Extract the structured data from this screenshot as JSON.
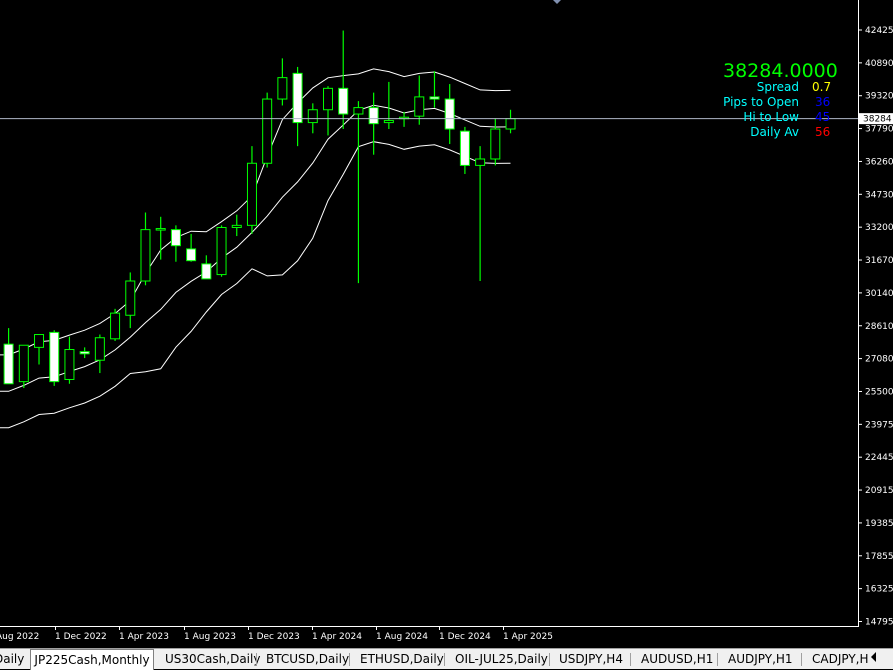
{
  "chart_data": {
    "type": "candlestick",
    "symbol": "JP225Cash",
    "timeframe": "Monthly",
    "price_ticks": [
      "42425",
      "40890",
      "39320",
      "37790",
      "36260",
      "34730",
      "33200",
      "31670",
      "30140",
      "28610",
      "27080",
      "25500",
      "23975",
      "22445",
      "20915",
      "19385",
      "17855",
      "16325",
      "14795"
    ],
    "date_ticks": [
      "Aug 2022",
      "1 Dec 2022",
      "1 Apr 2023",
      "1 Aug 2023",
      "1 Dec 2023",
      "1 Apr 2024",
      "1 Aug 2024",
      "1 Dec 2024",
      "1 Apr 2025"
    ],
    "current_price": "38284",
    "ylim": [
      14795,
      42425
    ],
    "colors": {
      "bull_body": "#000000",
      "bear_body": "#ffffff",
      "wick": "#00ff00",
      "bands": "#ffffff",
      "price_line": "#b0b8c8"
    },
    "candles": [
      {
        "o": 27750,
        "h": 28500,
        "l": 26200,
        "c": 25900
      },
      {
        "o": 26000,
        "h": 27700,
        "l": 25700,
        "c": 27700
      },
      {
        "o": 27600,
        "h": 28200,
        "l": 26800,
        "c": 28200
      },
      {
        "o": 28300,
        "h": 28400,
        "l": 25800,
        "c": 26000
      },
      {
        "o": 26100,
        "h": 28100,
        "l": 25900,
        "c": 27500
      },
      {
        "o": 27400,
        "h": 27600,
        "l": 27100,
        "c": 27300
      },
      {
        "o": 27000,
        "h": 28200,
        "l": 26400,
        "c": 28050
      },
      {
        "o": 28000,
        "h": 29400,
        "l": 27900,
        "c": 29200
      },
      {
        "o": 29100,
        "h": 31100,
        "l": 28500,
        "c": 30700
      },
      {
        "o": 30700,
        "h": 33900,
        "l": 30500,
        "c": 33100
      },
      {
        "o": 33100,
        "h": 33700,
        "l": 31700,
        "c": 33150
      },
      {
        "o": 33100,
        "h": 33300,
        "l": 31600,
        "c": 32350
      },
      {
        "o": 32200,
        "h": 32900,
        "l": 31600,
        "c": 31650
      },
      {
        "o": 31500,
        "h": 31900,
        "l": 30800,
        "c": 30800
      },
      {
        "o": 31000,
        "h": 33300,
        "l": 30900,
        "c": 33200
      },
      {
        "o": 33200,
        "h": 33800,
        "l": 32800,
        "c": 33300
      },
      {
        "o": 33300,
        "h": 37000,
        "l": 32900,
        "c": 36200
      },
      {
        "o": 36200,
        "h": 39500,
        "l": 36000,
        "c": 39200
      },
      {
        "o": 39200,
        "h": 41100,
        "l": 38900,
        "c": 40200
      },
      {
        "o": 40400,
        "h": 40700,
        "l": 37000,
        "c": 38100
      },
      {
        "o": 38100,
        "h": 39000,
        "l": 37600,
        "c": 38700
      },
      {
        "o": 38700,
        "h": 39800,
        "l": 37500,
        "c": 39700
      },
      {
        "o": 39700,
        "h": 42400,
        "l": 37800,
        "c": 38500
      },
      {
        "o": 38500,
        "h": 39100,
        "l": 30600,
        "c": 38800
      },
      {
        "o": 38800,
        "h": 39500,
        "l": 36600,
        "c": 38050
      },
      {
        "o": 38100,
        "h": 40000,
        "l": 37800,
        "c": 38200
      },
      {
        "o": 38300,
        "h": 38600,
        "l": 37900,
        "c": 38350
      },
      {
        "o": 38400,
        "h": 40300,
        "l": 38000,
        "c": 39300
      },
      {
        "o": 39300,
        "h": 40500,
        "l": 38800,
        "c": 39200
      },
      {
        "o": 39200,
        "h": 39900,
        "l": 37100,
        "c": 37800
      },
      {
        "o": 37700,
        "h": 37900,
        "l": 35700,
        "c": 36100
      },
      {
        "o": 36100,
        "h": 37000,
        "l": 30700,
        "c": 36400
      },
      {
        "o": 36400,
        "h": 38300,
        "l": 36100,
        "c": 37800
      },
      {
        "o": 37800,
        "h": 38700,
        "l": 37600,
        "c": 38284
      }
    ],
    "bands": {
      "upper": [
        null,
        null,
        null,
        null,
        null,
        null,
        null,
        null,
        null,
        null,
        null,
        null,
        null,
        null,
        null,
        null,
        null,
        null,
        null,
        null,
        null,
        null,
        null,
        null,
        null,
        null,
        null,
        null,
        null,
        null,
        null,
        null,
        null,
        null
      ],
      "middle": [],
      "lower": []
    }
  },
  "info_panel": {
    "price": "38284.0000",
    "spread_label": "Spread",
    "spread_value": "0.7",
    "pips_to_open_label": "Pips to Open",
    "pips_to_open_value": "36",
    "hi_to_low_label": "Hi to Low",
    "hi_to_low_value": "45",
    "daily_av_label": "Daily Av",
    "daily_av_value": "56",
    "colors": {
      "price": "#00ff00",
      "labels": "#00ffff",
      "spread_value": "#ffff00",
      "pips_value": "#0000ff",
      "hilo_value": "#0000ff",
      "dailyav_value": "#ff0000"
    }
  },
  "tabs": [
    {
      "label": "Daily"
    },
    {
      "label": "JP225Cash,Monthly"
    },
    {
      "label": "US30Cash,Daily"
    },
    {
      "label": "BTCUSD,Daily"
    },
    {
      "label": "ETHUSD,Daily"
    },
    {
      "label": "OIL-JUL25,Daily"
    },
    {
      "label": "USDJPY,H4"
    },
    {
      "label": "AUDUSD,H1"
    },
    {
      "label": "AUDJPY,H1"
    },
    {
      "label": "CADJPY,H"
    }
  ],
  "tab_scroll_icon": "triangle-left-icon"
}
